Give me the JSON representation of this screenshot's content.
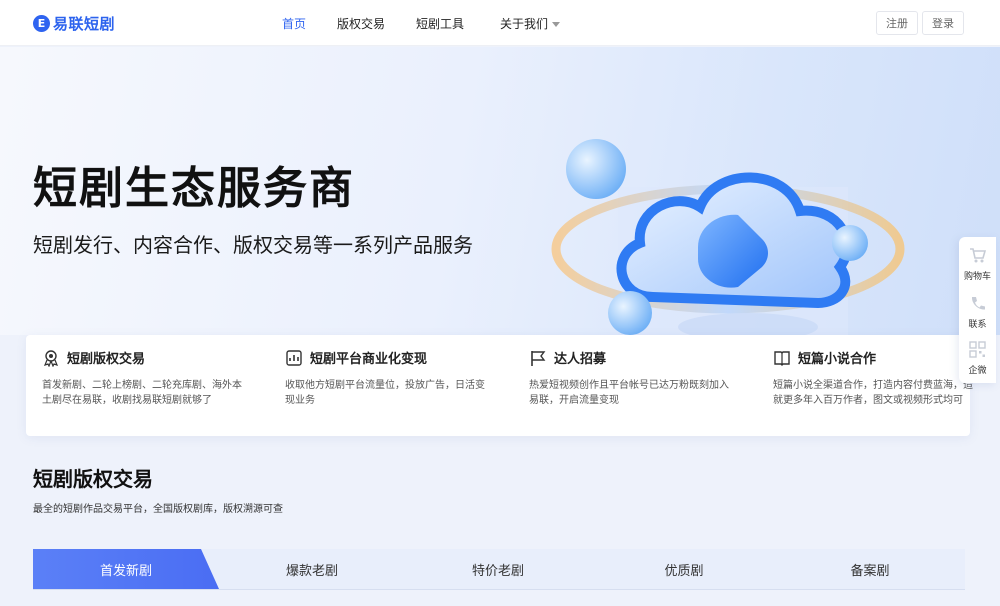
{
  "header": {
    "logo_mark": "E",
    "logo_text": "易联短剧",
    "nav": [
      "首页",
      "版权交易",
      "短剧工具",
      "关于我们"
    ],
    "register": "注册",
    "login": "登录"
  },
  "hero": {
    "title": "短剧生态服务商",
    "subtitle": "短剧发行、内容合作、版权交易等一系列产品服务"
  },
  "features": [
    {
      "title": "短剧版权交易",
      "desc": "首发新剧、二轮上榜剧、二轮充库剧、海外本土剧尽在易联，收剧找易联短剧就够了",
      "icon": "award-icon"
    },
    {
      "title": "短剧平台商业化变现",
      "desc": "收取他方短剧平台流量位，投放广告，日活变现业务",
      "icon": "document-chart-icon"
    },
    {
      "title": "达人招募",
      "desc": "热爱短视频创作且平台帐号已达万粉既刻加入易联，开启流量变现",
      "icon": "flag-icon"
    },
    {
      "title": "短篇小说合作",
      "desc": "短篇小说全渠道合作，打造内容付费蓝海，造就更多年入百万作者，图文或视频形式均可",
      "icon": "book-icon"
    }
  ],
  "section": {
    "title": "短剧版权交易",
    "subtitle": "最全的短剧作品交易平台，全国版权剧库，版权溯源可查"
  },
  "tabs": [
    "首发新剧",
    "爆款老剧",
    "特价老剧",
    "优质剧",
    "备案剧"
  ],
  "sidebar": [
    {
      "label": "购物车",
      "icon": "cart-icon"
    },
    {
      "label": "联系",
      "icon": "phone-icon"
    },
    {
      "label": "企微",
      "icon": "qrcode-icon"
    }
  ],
  "colors": {
    "brand": "#2f64f0",
    "tab_active": "#4a6df3"
  }
}
